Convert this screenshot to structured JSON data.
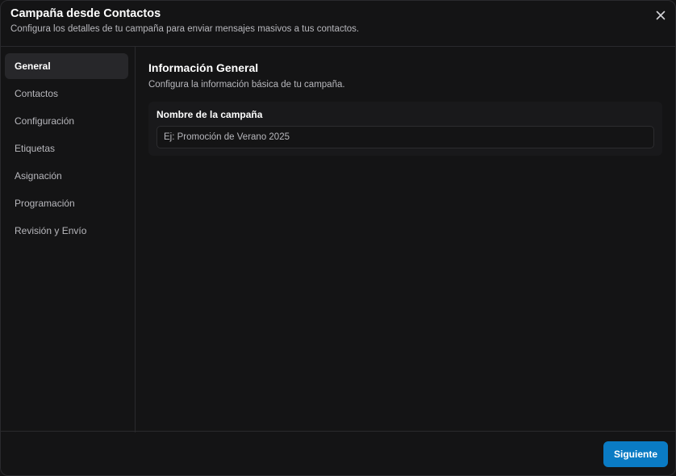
{
  "dialog": {
    "title": "Campaña desde Contactos",
    "subtitle": "Configura los detalles de tu campaña para enviar mensajes masivos a tus contactos.",
    "close_icon": "close-icon"
  },
  "sidebar": {
    "items": [
      {
        "label": "General",
        "active": true
      },
      {
        "label": "Contactos",
        "active": false
      },
      {
        "label": "Configuración",
        "active": false
      },
      {
        "label": "Etiquetas",
        "active": false
      },
      {
        "label": "Asignación",
        "active": false
      },
      {
        "label": "Programación",
        "active": false
      },
      {
        "label": "Revisión y Envío",
        "active": false
      }
    ]
  },
  "main": {
    "section_title": "Información General",
    "section_desc": "Configura la información básica de tu campaña.",
    "field": {
      "label": "Nombre de la campaña",
      "value": "",
      "placeholder": "Ej: Promoción de Verano 2025"
    }
  },
  "footer": {
    "next_label": "Siguiente"
  },
  "colors": {
    "background": "#141415",
    "accent": "#0a7bc4",
    "active_item": "#27272a"
  }
}
